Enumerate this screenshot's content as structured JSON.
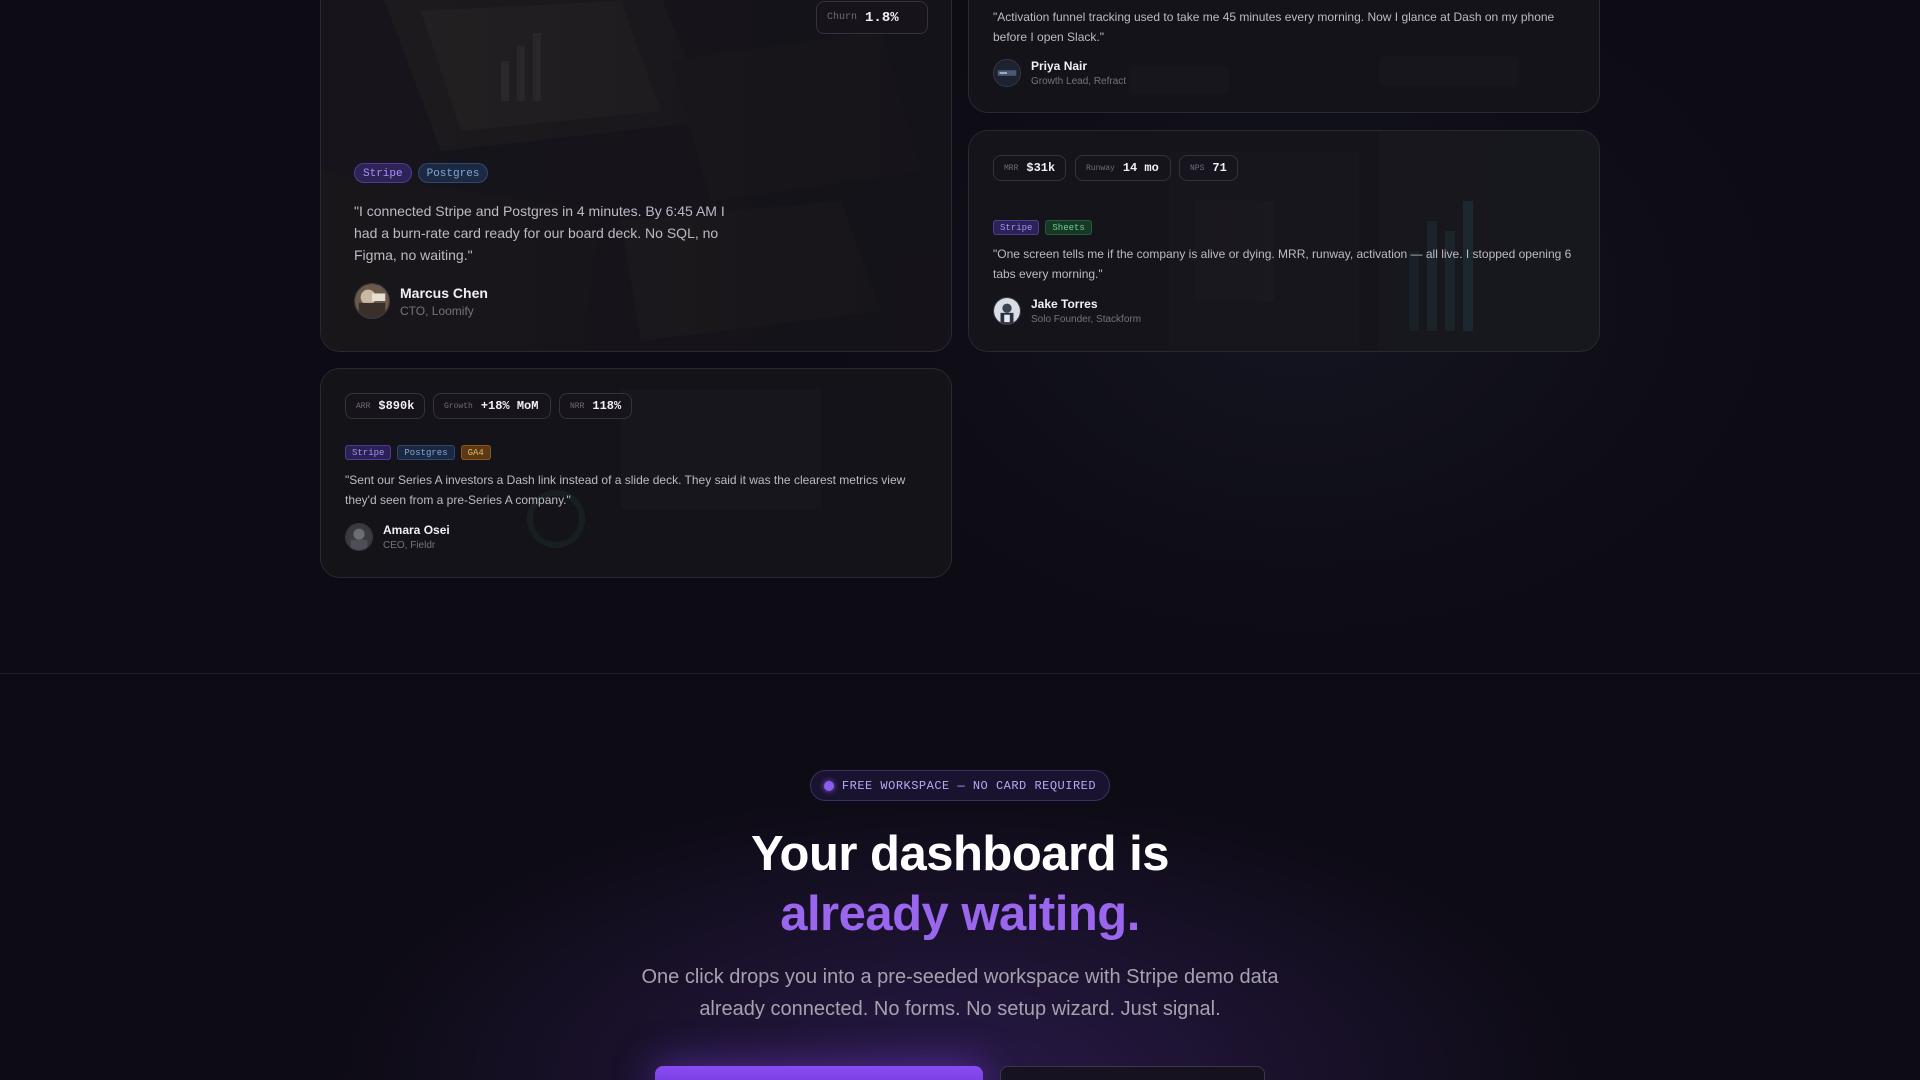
{
  "card_marcus": {
    "metric": {
      "key": "Churn",
      "value": "1.8%"
    },
    "tags": [
      "Stripe",
      "Postgres"
    ],
    "quote": "\"I connected Stripe and Postgres in 4 minutes. By 6:45 AM I had a burn-rate card ready for our board deck. No SQL, no Figma, no waiting.\"",
    "name": "Marcus Chen",
    "role": "CTO, Loomify"
  },
  "card_priya": {
    "quote": "\"Activation funnel tracking used to take me 45 minutes every morning. Now I glance at Dash on my phone before I open Slack.\"",
    "name": "Priya Nair",
    "role": "Growth Lead, Refract"
  },
  "card_jake": {
    "metrics": [
      {
        "key": "MRR",
        "value": "$31k"
      },
      {
        "key": "Runway",
        "value": "14 mo"
      },
      {
        "key": "NPS",
        "value": "71"
      }
    ],
    "tags": [
      "Stripe",
      "Sheets"
    ],
    "quote": "\"One screen tells me if the company is alive or dying. MRR, runway, activation — all live. I stopped opening 6 tabs every morning.\"",
    "name": "Jake Torres",
    "role": "Solo Founder, Stackform"
  },
  "card_amara": {
    "metrics": [
      {
        "key": "ARR",
        "value": "$890k"
      },
      {
        "key": "Growth",
        "value": "+18% MoM"
      },
      {
        "key": "NRR",
        "value": "118%"
      }
    ],
    "tags": [
      "Stripe",
      "Postgres",
      "GA4"
    ],
    "quote": "\"Sent our Series A investors a Dash link instead of a slide deck. They said it was the clearest metrics view they'd seen from a pre-Series A company.\"",
    "name": "Amara Osei",
    "role": "CEO, Fieldr"
  },
  "cta_section": {
    "badge": "FREE WORKSPACE — NO CARD REQUIRED",
    "headline_1": "Your dashboard is",
    "headline_2": "already waiting.",
    "subtext": "One click drops you into a pre-seeded workspace with Stripe demo data already connected. No forms. No setup wizard. Just signal."
  },
  "colors": {
    "accent": "#9a66ee",
    "background": "#0d0b14",
    "tag_stripe": "#a592f5",
    "tag_postgres": "#7ea7d8",
    "tag_sheets": "#6fd08d",
    "tag_ga4": "#f0b35a"
  }
}
